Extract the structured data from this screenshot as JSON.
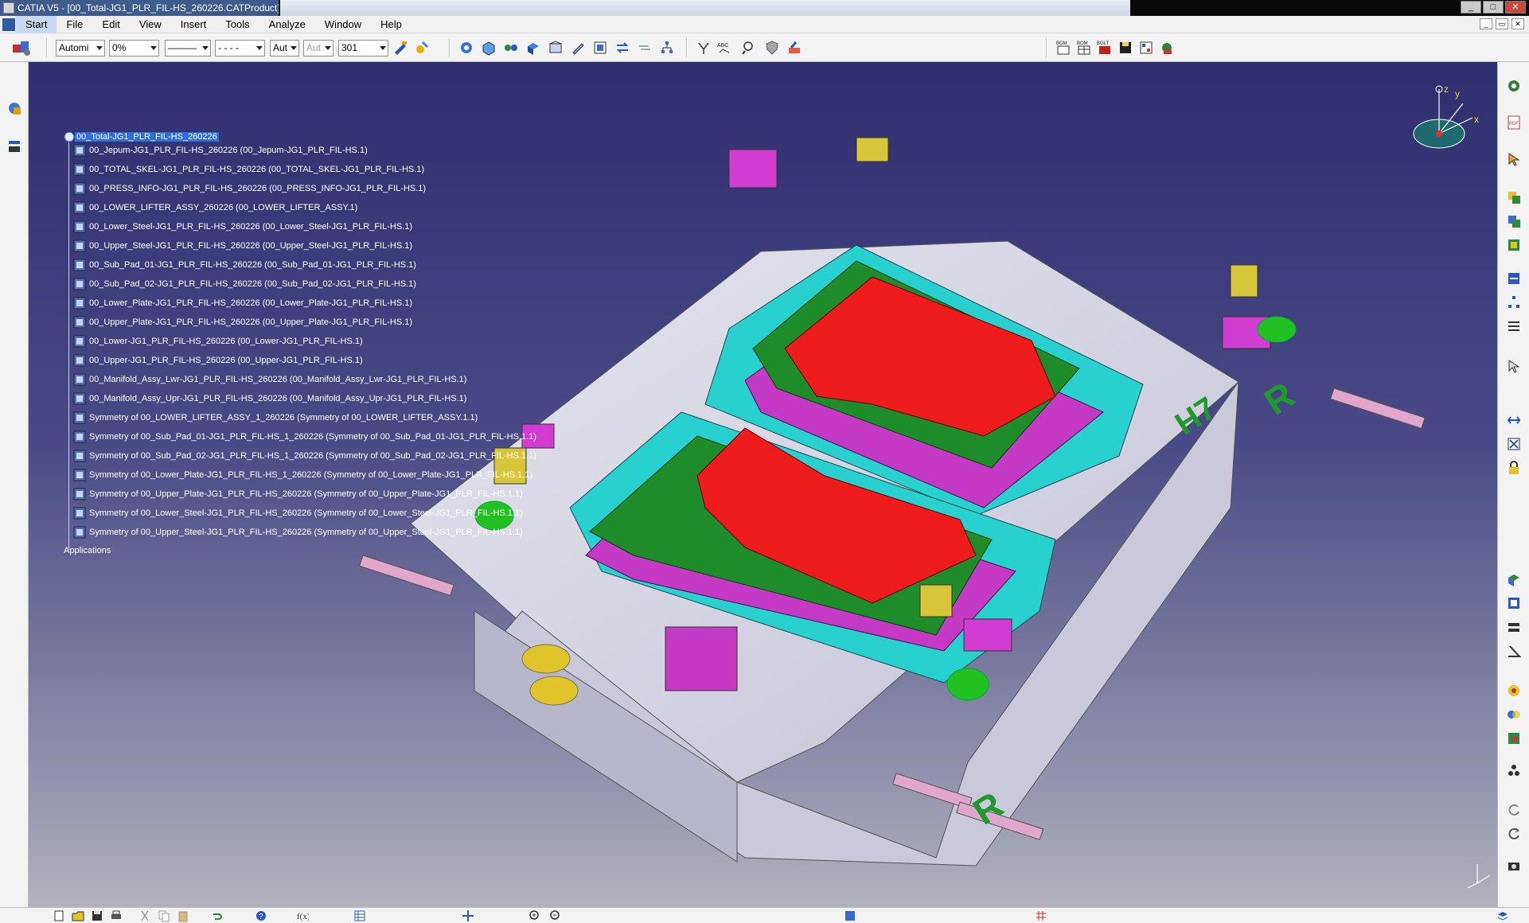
{
  "window": {
    "title": "CATIA V5 - [00_Total-JG1_PLR_FIL-HS_260226.CATProduct]",
    "buttons": [
      "_",
      "□",
      "✕"
    ]
  },
  "menubar": {
    "items": [
      "Start",
      "File",
      "Edit",
      "View",
      "Insert",
      "Tools",
      "Analyze",
      "Window",
      "Help"
    ]
  },
  "toolbar": {
    "combo_auto": "Automi",
    "combo_transparency": "0%",
    "combo_line": "———",
    "combo_dash": "- - - -",
    "combo_aut1": "Aut",
    "combo_aut2": "Aut",
    "combo_layer": "301",
    "bom1": "BOM",
    "bom2": "BOM",
    "bolt": "BOLT"
  },
  "tree": {
    "root": "00_Total-JG1_PLR_FIL-HS_260226",
    "items": [
      "00_Jepum-JG1_PLR_FIL-HS_260226 (00_Jepum-JG1_PLR_FIL-HS.1)",
      "00_TOTAL_SKEL-JG1_PLR_FIL-HS_260226 (00_TOTAL_SKEL-JG1_PLR_FIL-HS.1)",
      "00_PRESS_INFO-JG1_PLR_FIL-HS_260226 (00_PRESS_INFO-JG1_PLR_FIL-HS.1)",
      "00_LOWER_LIFTER_ASSY_260226 (00_LOWER_LIFTER_ASSY.1)",
      "00_Lower_Steel-JG1_PLR_FIL-HS_260226 (00_Lower_Steel-JG1_PLR_FIL-HS.1)",
      "00_Upper_Steel-JG1_PLR_FIL-HS_260226 (00_Upper_Steel-JG1_PLR_FIL-HS.1)",
      "00_Sub_Pad_01-JG1_PLR_FIL-HS_260226 (00_Sub_Pad_01-JG1_PLR_FIL-HS.1)",
      "00_Sub_Pad_02-JG1_PLR_FIL-HS_260226 (00_Sub_Pad_02-JG1_PLR_FIL-HS.1)",
      "00_Lower_Plate-JG1_PLR_FIL-HS_260226 (00_Lower_Plate-JG1_PLR_FIL-HS.1)",
      "00_Upper_Plate-JG1_PLR_FIL-HS_260226 (00_Upper_Plate-JG1_PLR_FIL-HS.1)",
      "00_Lower-JG1_PLR_FIL-HS_260226 (00_Lower-JG1_PLR_FIL-HS.1)",
      "00_Upper-JG1_PLR_FIL-HS_260226 (00_Upper-JG1_PLR_FIL-HS.1)",
      "00_Manifold_Assy_Lwr-JG1_PLR_FIL-HS_260226 (00_Manifold_Assy_Lwr-JG1_PLR_FIL-HS.1)",
      "00_Manifold_Assy_Upr-JG1_PLR_FIL-HS_260226 (00_Manifold_Assy_Upr-JG1_PLR_FIL-HS.1)",
      "Symmetry of 00_LOWER_LIFTER_ASSY_1_260226 (Symmetry of 00_LOWER_LIFTER_ASSY.1.1)",
      "Symmetry of 00_Sub_Pad_01-JG1_PLR_FIL-HS_1_260226 (Symmetry of 00_Sub_Pad_01-JG1_PLR_FIL-HS.1.1)",
      "Symmetry of 00_Sub_Pad_02-JG1_PLR_FIL-HS_1_260226 (Symmetry of 00_Sub_Pad_02-JG1_PLR_FIL-HS.1.1)",
      "Symmetry of 00_Lower_Plate-JG1_PLR_FIL-HS_1_260226 (Symmetry of 00_Lower_Plate-JG1_PLR_FIL-HS.1.1)",
      "Symmetry of 00_Upper_Plate-JG1_PLR_FIL-HS_260226 (Symmetry of 00_Upper_Plate-JG1_PLR_FIL-HS.1.1)",
      "Symmetry of 00_Lower_Steel-JG1_PLR_FIL-HS_260226 (Symmetry of 00_Lower_Steel-JG1_PLR_FIL-HS.1.1)",
      "Symmetry of 00_Upper_Steel-JG1_PLR_FIL-HS_260226 (Symmetry of 00_Upper_Steel-JG1_PLR_FIL-HS.1.1)"
    ],
    "applications": "Applications"
  },
  "model": {
    "label_h7": "H7",
    "label_r": "R"
  },
  "compass": {
    "y": "y",
    "x": "x",
    "z": "z"
  },
  "colors": {
    "viewport_top": "#2e2e70",
    "viewport_bottom": "#b1b1bd",
    "part_red": "#ee1c1c",
    "part_green": "#1f8c2a",
    "part_cyan": "#27cfcf",
    "part_magenta": "#c732c7",
    "base_grey": "#d5d5e3"
  }
}
